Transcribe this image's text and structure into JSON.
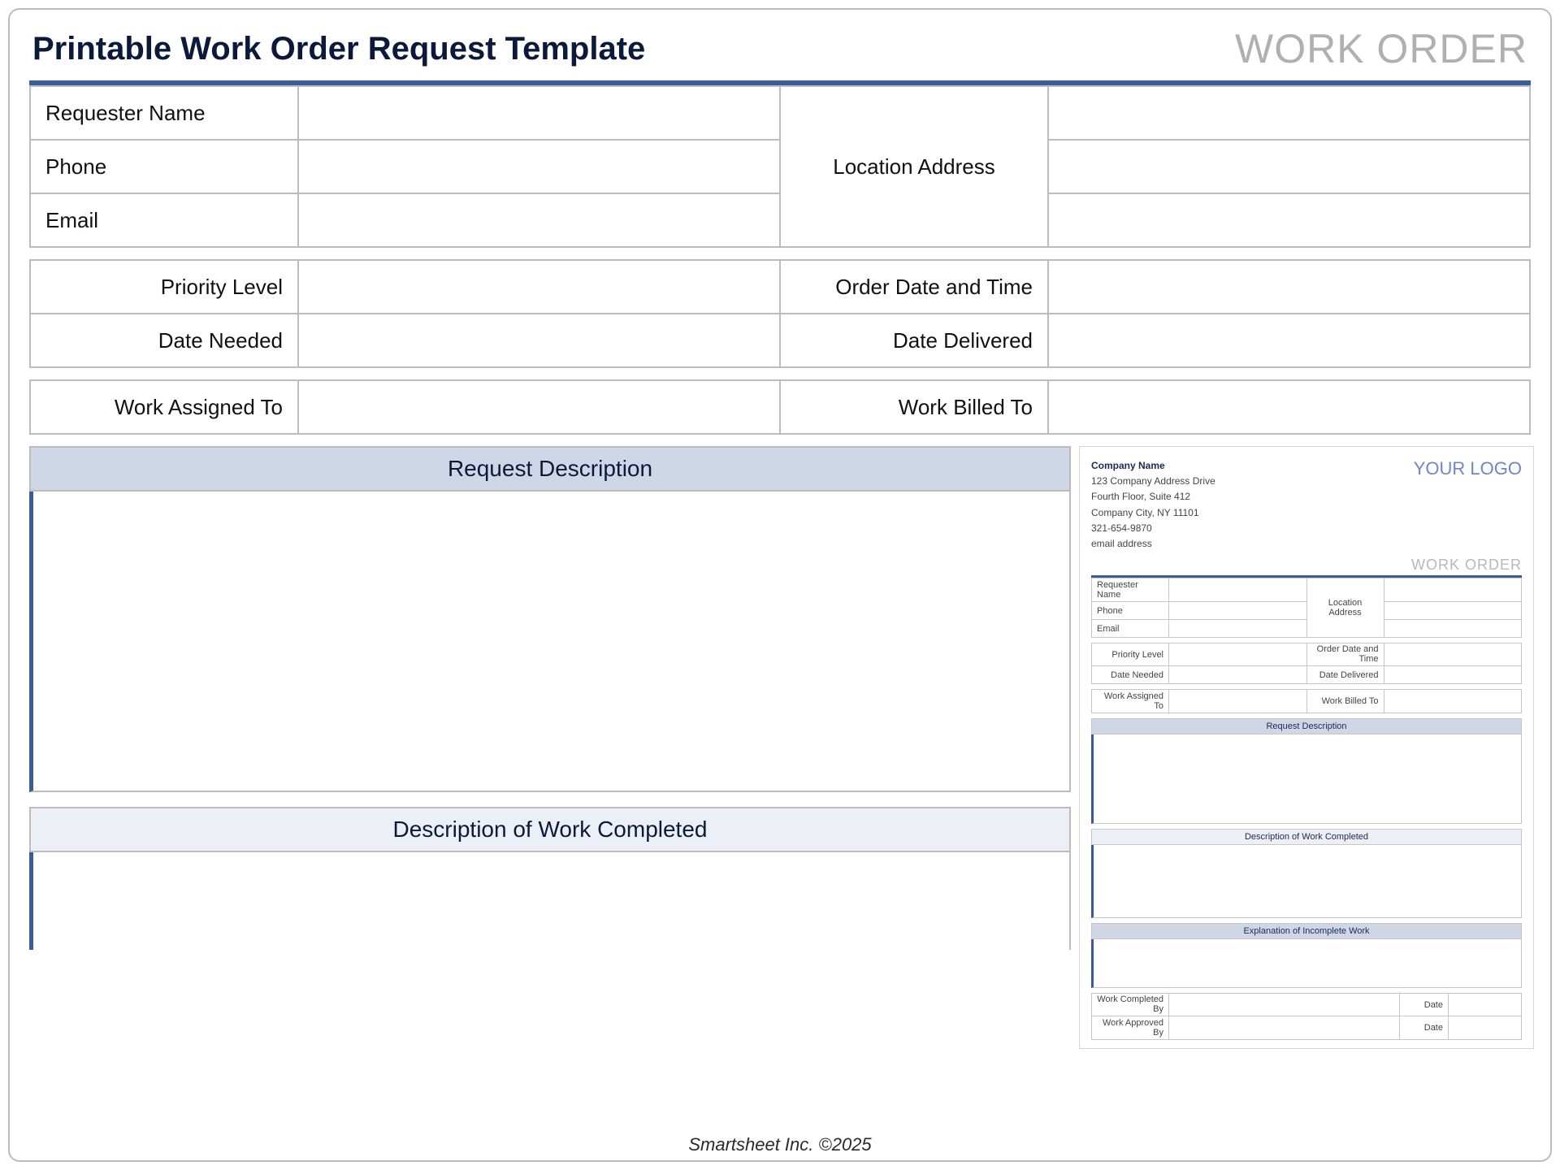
{
  "header": {
    "title": "Printable Work Order Request Template",
    "mark": "WORK ORDER"
  },
  "form": {
    "requester_name_label": "Requester Name",
    "phone_label": "Phone",
    "email_label": "Email",
    "location_address_label": "Location Address",
    "priority_level_label": "Priority Level",
    "order_datetime_label": "Order Date and Time",
    "date_needed_label": "Date Needed",
    "date_delivered_label": "Date Delivered",
    "work_assigned_to_label": "Work Assigned To",
    "work_billed_to_label": "Work Billed To",
    "request_description_label": "Request Description",
    "description_completed_label": "Description of Work Completed"
  },
  "preview": {
    "company_name": "Company Name",
    "addr1": "123 Company Address Drive",
    "addr2": "Fourth Floor, Suite 412",
    "addr3": "Company City, NY  11101",
    "phone": "321-654-9870",
    "email": "email address",
    "logo_text": "YOUR LOGO",
    "wo_text": "WORK ORDER",
    "labels": {
      "requester_name": "Requester Name",
      "phone": "Phone",
      "email": "Email",
      "location_address": "Location Address",
      "priority_level": "Priority Level",
      "order_datetime": "Order Date and Time",
      "date_needed": "Date Needed",
      "date_delivered": "Date Delivered",
      "work_assigned_to": "Work Assigned To",
      "work_billed_to": "Work Billed To",
      "request_description": "Request Description",
      "description_completed": "Description of Work Completed",
      "explanation_incomplete": "Explanation of Incomplete Work",
      "work_completed_by": "Work Completed By",
      "work_approved_by": "Work Approved By",
      "date": "Date"
    }
  },
  "footer": "Smartsheet Inc. ©2025"
}
